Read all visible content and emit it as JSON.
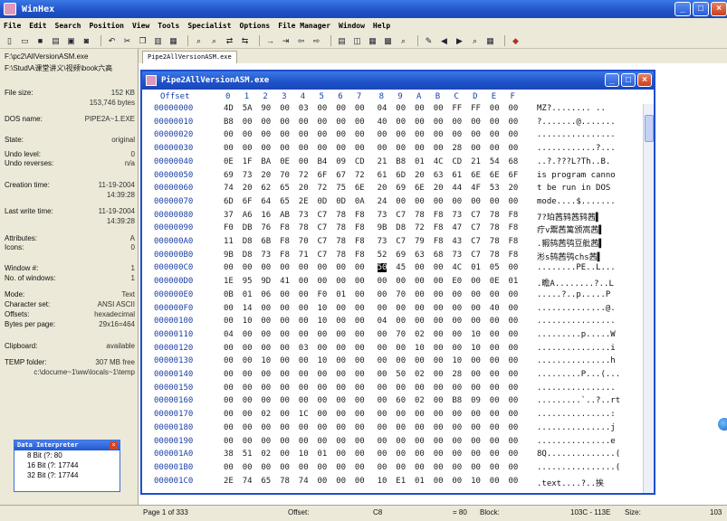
{
  "window": {
    "title": "WinHex"
  },
  "menu": [
    "File",
    "Edit",
    "Search",
    "Position",
    "View",
    "Tools",
    "Specialist",
    "Options",
    "File Manager",
    "Window",
    "Help"
  ],
  "side": {
    "path1": "F:\\pc2\\AllVersionASM.exe",
    "path2": "F:\\Stud\\A课堂讲义\\视频\\book六高",
    "rows": [
      {
        "label": "File size:",
        "value": "152 KB"
      },
      {
        "label": "",
        "value": "153,746 bytes"
      },
      {
        "label": "DOS name:",
        "value": "PIPE2A~1.EXE"
      },
      {
        "label": "State:",
        "value": "original"
      },
      {
        "label": "Undo level:",
        "value": "0"
      },
      {
        "label": "Undo reverses:",
        "value": "n/a"
      },
      {
        "label": "Creation time:",
        "value": "11-19-2004"
      },
      {
        "label": "",
        "value": "14:39:28"
      },
      {
        "label": "Last write time:",
        "value": "11-19-2004"
      },
      {
        "label": "",
        "value": "14:39:28"
      },
      {
        "label": "Attributes:",
        "value": "A"
      },
      {
        "label": "Icons:",
        "value": "0"
      },
      {
        "label": "Window #:",
        "value": "1"
      },
      {
        "label": "No. of windows:",
        "value": "1"
      },
      {
        "label": "Mode:",
        "value": "Text"
      },
      {
        "label": "Character set:",
        "value": "ANSI ASCII"
      },
      {
        "label": "Offsets:",
        "value": "hexadecimal"
      },
      {
        "label": "Bytes per page:",
        "value": "29x16=464"
      },
      {
        "label": "Clipboard:",
        "value": "available"
      },
      {
        "label": "TEMP folder:",
        "value": "307 MB free"
      },
      {
        "label": "",
        "value": "c:\\docume~1\\ww\\locals~1\\temp"
      }
    ]
  },
  "interpreter": {
    "title": "Data Interpreter",
    "rows": [
      "8 Bit (?: 80",
      "16 Bit (?: 17744",
      "32 Bit (?: 17744"
    ]
  },
  "tab": {
    "label": "Pipe2AllVersionASM.exe"
  },
  "hexwin": {
    "title": "Pipe2AllVersionASM.exe",
    "offset_label": "Offset",
    "cols": [
      "0",
      "1",
      "2",
      "3",
      "4",
      "5",
      "6",
      "7",
      "8",
      "9",
      "A",
      "B",
      "C",
      "D",
      "E",
      "F"
    ],
    "rows": [
      {
        "off": "00000000",
        "bytes": "4D 5A 90 00 03 00 00 00 04 00 00 00 FF FF 00 00",
        "text": "MZ?........  .."
      },
      {
        "off": "00000010",
        "bytes": "B8 00 00 00 00 00 00 00 40 00 00 00 00 00 00 00",
        "text": "?.......@......."
      },
      {
        "off": "00000020",
        "bytes": "00 00 00 00 00 00 00 00 00 00 00 00 00 00 00 00",
        "text": "................"
      },
      {
        "off": "00000030",
        "bytes": "00 00 00 00 00 00 00 00 00 00 00 00 28 00 00 00",
        "text": "............?..."
      },
      {
        "off": "00000040",
        "bytes": "0E 1F BA 0E 00 B4 09 CD 21 B8 01 4C CD 21 54 68",
        "text": "..?.???L?Th..B."
      },
      {
        "off": "00000050",
        "bytes": "69 73 20 70 72 6F 67 72 61 6D 20 63 61 6E 6E 6F",
        "text": "is program canno"
      },
      {
        "off": "00000060",
        "bytes": "74 20 62 65 20 72 75 6E 20 69 6E 20 44 4F 53 20",
        "text": "t be run in DOS"
      },
      {
        "off": "00000070",
        "bytes": "6D 6F 64 65 2E 0D 0D 0A 24 00 00 00 00 00 00 00",
        "text": "mode....$......."
      },
      {
        "off": "00000080",
        "bytes": "37 A6 16 AB 73 C7 78 F8 73 C7 78 F8 73 C7 78 F8",
        "text": "7?珀茜鸫茜鸫茜▌"
      },
      {
        "off": "00000090",
        "bytes": "F0 DB 76 F8 78 C7 78 F8 9B D8 72 F8 47 C7 78 F8",
        "text": "疔v鬻茜篱颁嵩茜▌"
      },
      {
        "off": "000000A0",
        "bytes": "11 D8 6B F8 70 C7 78 F8 73 C7 79 F8 43 C7 78 F8",
        "text": ".豭鸫茜鸮豆舭茜▌"
      },
      {
        "off": "000000B0",
        "bytes": "9B D8 73 F8 71 C7 78 F8 52 69 63 68 73 C7 78 F8",
        "text": "涁s鸫茜鸮chs茜▌"
      },
      {
        "off": "000000C0",
        "bytes": "00 00 00 00 00 00 00 00 50 45 00 00 4C 01 05 00",
        "text": "........PE..L..."
      },
      {
        "off": "000000D0",
        "bytes": "1E 95 9D 41 00 00 00 00 00 00 00 00 E0 00 0E 01",
        "text": ".瞻A........?..L"
      },
      {
        "off": "000000E0",
        "bytes": "0B 01 06 00 00 F0 01 00 00 70 00 00 00 00 00 00",
        "text": ".....?..p.....P"
      },
      {
        "off": "000000F0",
        "bytes": "00 14 00 00 00 10 00 00 00 00 00 00 00 00 40 00",
        "text": "..............@."
      },
      {
        "off": "00000100",
        "bytes": "00 10 00 00 00 10 00 00 04 00 00 00 00 00 00 00",
        "text": "................"
      },
      {
        "off": "00000110",
        "bytes": "04 00 00 00 00 00 00 00 00 70 02 00 00 10 00 00",
        "text": ".........p.....W"
      },
      {
        "off": "00000120",
        "bytes": "00 00 00 00 03 00 00 00 00 00 10 00 00 10 00 00",
        "text": "...............i"
      },
      {
        "off": "00000130",
        "bytes": "00 00 10 00 00 10 00 00 00 00 00 00 10 00 00 00",
        "text": "...............h"
      },
      {
        "off": "00000140",
        "bytes": "00 00 00 00 00 00 00 00 00 50 02 00 28 00 00 00",
        "text": ".........P...(..."
      },
      {
        "off": "00000150",
        "bytes": "00 00 00 00 00 00 00 00 00 00 00 00 00 00 00 00",
        "text": "................"
      },
      {
        "off": "00000160",
        "bytes": "00 00 00 00 00 00 00 00 00 60 02 00 B8 09 00 00",
        "text": ".........`..?..rt"
      },
      {
        "off": "00000170",
        "bytes": "00 00 02 00 1C 00 00 00 00 00 00 00 00 00 00 00",
        "text": "...............:"
      },
      {
        "off": "00000180",
        "bytes": "00 00 00 00 00 00 00 00 00 00 00 00 00 00 00 00",
        "text": "...............j"
      },
      {
        "off": "00000190",
        "bytes": "00 00 00 00 00 00 00 00 00 00 00 00 00 00 00 00",
        "text": "...............e"
      },
      {
        "off": "000001A0",
        "bytes": "38 51 02 00 10 01 00 00 00 00 00 00 00 00 00 00",
        "text": "8Q..............("
      },
      {
        "off": "000001B0",
        "bytes": "00 00 00 00 00 00 00 00 00 00 00 00 00 00 00 00",
        "text": "................("
      },
      {
        "off": "000001C0",
        "bytes": "2E 74 65 78 74 00 00 00 10 E1 01 00 00 10 00 00",
        "text": ".text....?..挨"
      }
    ]
  },
  "status": {
    "page": "Page 1 of 333",
    "offset_label": "Offset:",
    "offset_val": "C8",
    "eq": "= 80",
    "block_label": "Block:",
    "block_val": "103C - 113E",
    "size_label": "Size:",
    "size_val": "103"
  }
}
